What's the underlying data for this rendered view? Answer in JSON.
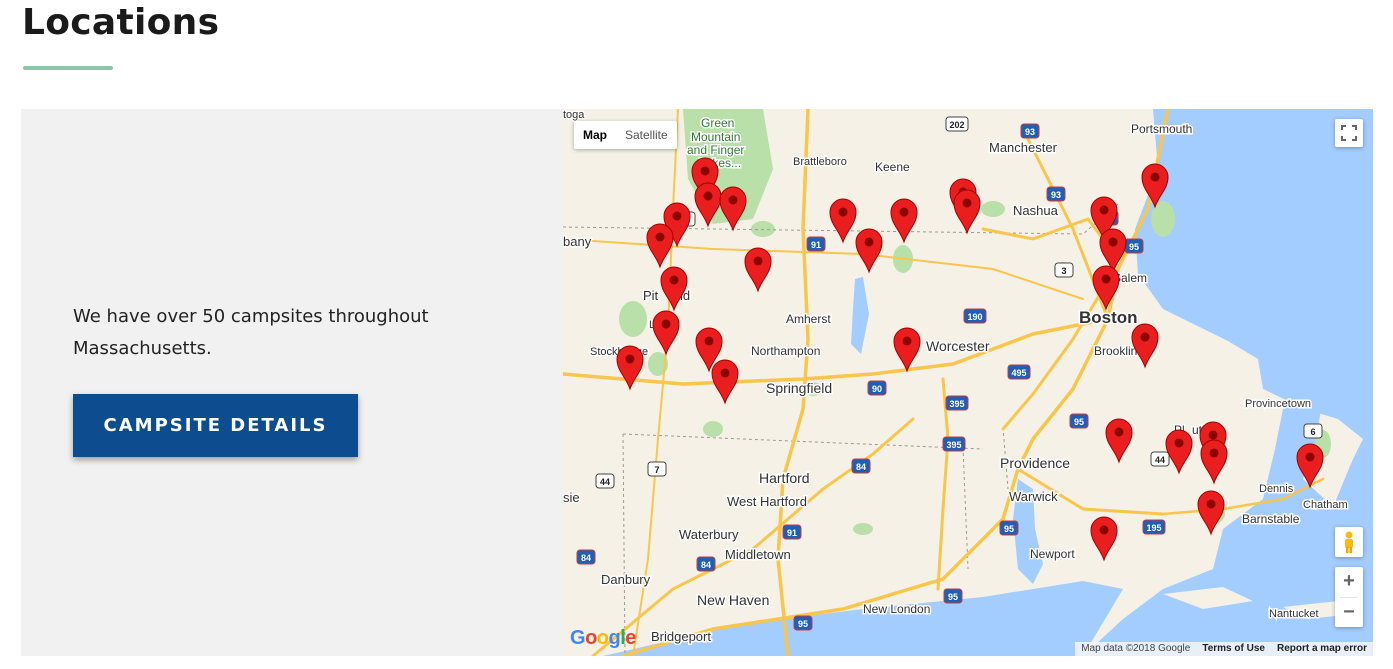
{
  "page": {
    "title": "Locations"
  },
  "intro": {
    "text": "We have over 50 campsites throughout Massachusetts.",
    "button_label": "CAMPSITE DETAILS"
  },
  "map": {
    "type_control": {
      "map": "Map",
      "satellite": "Satellite",
      "selected": "Map"
    },
    "google_logo": "Google",
    "attribution": {
      "data": "Map data ©2018 Google",
      "terms": "Terms of Use",
      "report": "Report a map error"
    },
    "zoom": {
      "in": "+",
      "out": "−"
    },
    "icons": [
      "fullscreen-icon",
      "pegman-icon",
      "map-marker-icon"
    ],
    "colors": {
      "water": "#a3ccff",
      "land": "#f5f1e6",
      "park": "#b8e0a8",
      "highway": "#f9c54a",
      "marker": "#ea1e1e"
    },
    "place_labels": [
      {
        "text": "toga",
        "size": 11
      },
      {
        "text": "Green",
        "size": 12,
        "color": "#2e7d32"
      },
      {
        "text": "Mountain",
        "size": 12,
        "color": "#2e7d32"
      },
      {
        "text": "and Finger",
        "size": 12,
        "color": "#2e7d32"
      },
      {
        "text": "Lakes...",
        "size": 12,
        "color": "#2e7d32"
      },
      {
        "text": "Portsmouth",
        "size": 12
      },
      {
        "text": "Manchester",
        "size": 13
      },
      {
        "text": "Keene",
        "size": 12
      },
      {
        "text": "Brattleboro",
        "size": 11
      },
      {
        "text": "Nashua",
        "size": 13
      },
      {
        "text": "bany",
        "size": 13
      },
      {
        "text": "Pit",
        "size": 13
      },
      {
        "text": "ld",
        "size": 13
      },
      {
        "text": "Len",
        "size": 11
      },
      {
        "text": "Amherst",
        "size": 12
      },
      {
        "text": "Salem",
        "size": 12
      },
      {
        "text": "Boston",
        "size": 17,
        "bold": true
      },
      {
        "text": "Stockbridge",
        "size": 11
      },
      {
        "text": "Northampton",
        "size": 12
      },
      {
        "text": "Worcester",
        "size": 14
      },
      {
        "text": "Brookline",
        "size": 12
      },
      {
        "text": "Springfield",
        "size": 14
      },
      {
        "text": "Provincetown",
        "size": 11
      },
      {
        "text": "Pl",
        "size": 12
      },
      {
        "text": "uth",
        "size": 12
      },
      {
        "text": "Providence",
        "size": 14
      },
      {
        "text": "Dennis",
        "size": 11
      },
      {
        "text": "Hartford",
        "size": 14
      },
      {
        "text": "West Hartford",
        "size": 13
      },
      {
        "text": "Warwick",
        "size": 13
      },
      {
        "text": "Chatham",
        "size": 11
      },
      {
        "text": "sie",
        "size": 13
      },
      {
        "text": "Barnstable",
        "size": 12
      },
      {
        "text": "Waterbury",
        "size": 13
      },
      {
        "text": "Middletown",
        "size": 13
      },
      {
        "text": "Newport",
        "size": 12
      },
      {
        "text": "Danbury",
        "size": 13
      },
      {
        "text": "New Haven",
        "size": 14
      },
      {
        "text": "New London",
        "size": 12
      },
      {
        "text": "Nantucket",
        "size": 11
      },
      {
        "text": "Bridgeport",
        "size": 13
      }
    ],
    "route_shields": [
      "202",
      "93",
      "93",
      "495",
      "95",
      "7",
      "91",
      "3",
      "190",
      "495",
      "90",
      "395",
      "95",
      "395",
      "84",
      "44",
      "7",
      "44",
      "6",
      "195",
      "91",
      "95",
      "84",
      "84",
      "95",
      "95"
    ]
  }
}
